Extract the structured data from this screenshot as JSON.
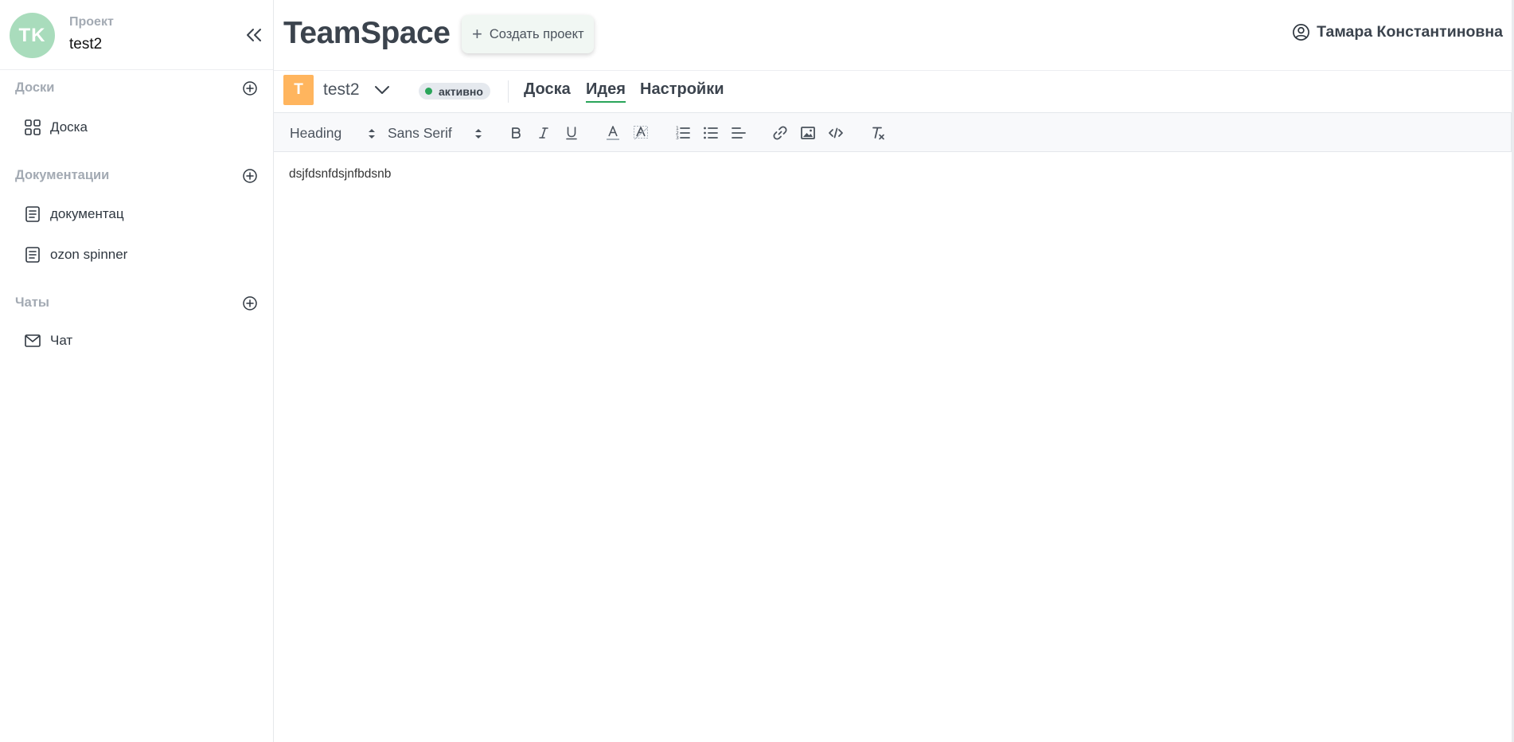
{
  "sidebar": {
    "avatar_initials": "TK",
    "project_caption": "Проект",
    "project_name": "test2",
    "sections": [
      {
        "title": "Доски",
        "items": [
          {
            "label": "Доска",
            "icon": "grid-icon"
          }
        ]
      },
      {
        "title": "Документации",
        "items": [
          {
            "label": "документац",
            "icon": "document-icon"
          },
          {
            "label": "ozon spinner",
            "icon": "document-icon"
          }
        ]
      },
      {
        "title": "Чаты",
        "items": [
          {
            "label": "Чат",
            "icon": "mail-icon"
          }
        ]
      }
    ]
  },
  "header": {
    "app_title": "TeamSpace",
    "create_project_label": "Создать проект",
    "user_name": "Тамара Константиновна"
  },
  "project_bar": {
    "badge_letter": "T",
    "project_name": "test2",
    "status": "активно",
    "tabs": [
      "Доска",
      "Идея",
      "Настройки"
    ],
    "active_tab": "Идея"
  },
  "toolbar": {
    "heading_select": "Heading",
    "font_select": "Sans Serif",
    "buttons": [
      "bold-icon",
      "italic-icon",
      "underline-icon",
      "text-color-icon",
      "highlight-icon",
      "ordered-list-icon",
      "bullet-list-icon",
      "align-left-icon",
      "link-icon",
      "image-icon",
      "code-icon",
      "clear-format-icon"
    ]
  },
  "editor": {
    "content": "dsjfdsnfdsjnfbdsnb"
  },
  "colors": {
    "accent_green": "#2aa55a",
    "avatar_bg": "#a9dcbc",
    "badge_orange": "#ffb55e",
    "muted_text": "#a3aab3"
  }
}
